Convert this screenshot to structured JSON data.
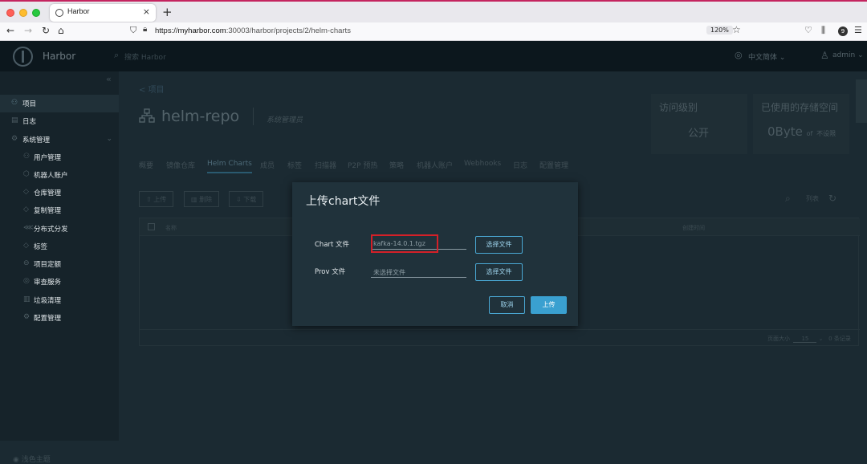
{
  "browser": {
    "tab_title": "Harbor",
    "tab_close": "×",
    "new_tab": "+",
    "url_scheme": "https://",
    "url_host": "myharbor.com",
    "url_path": ":30003/harbor/projects/2/helm-charts",
    "zoom": "120%",
    "badge_count": "9"
  },
  "header": {
    "brand": "Harbor",
    "search_placeholder": "搜索 Harbor",
    "language": "中文简体",
    "user": "admin"
  },
  "sidebar": {
    "items": [
      {
        "label": "项目",
        "icon": "project-icon"
      },
      {
        "label": "日志",
        "icon": "log-icon"
      },
      {
        "label": "系统管理",
        "icon": "admin-icon"
      },
      {
        "label": "用户管理",
        "icon": "users-icon"
      },
      {
        "label": "机器人账户",
        "icon": "robot-icon"
      },
      {
        "label": "仓库管理",
        "icon": "registry-icon"
      },
      {
        "label": "复制管理",
        "icon": "replication-icon"
      },
      {
        "label": "分布式分发",
        "icon": "distribution-icon"
      },
      {
        "label": "标签",
        "icon": "label-icon"
      },
      {
        "label": "项目定额",
        "icon": "quota-icon"
      },
      {
        "label": "审查服务",
        "icon": "scanner-icon"
      },
      {
        "label": "垃圾清理",
        "icon": "trash-icon"
      },
      {
        "label": "配置管理",
        "icon": "config-icon"
      }
    ],
    "theme_toggle": "浅色主题"
  },
  "project": {
    "back_link": "< 项目",
    "name": "helm-repo",
    "role": "系统管理员",
    "access_label": "访问级别",
    "access_value": "公开",
    "storage_label": "已使用的存储空间",
    "storage_value": "0Byte",
    "storage_of": "of",
    "storage_limit": "不设限"
  },
  "tabs": [
    "概要",
    "镜像仓库",
    "Helm Charts",
    "成员",
    "标签",
    "扫描器",
    "P2P 预热",
    "策略",
    "机器人账户",
    "Webhooks",
    "日志",
    "配置管理"
  ],
  "active_tab": "Helm Charts",
  "toolbar": {
    "upload": "上传",
    "delete": "删除",
    "download": "下载",
    "view_list": "列表"
  },
  "grid": {
    "col_name": "名称",
    "col_created": "创建时间",
    "page_size_label": "页面大小",
    "page_size": "15",
    "total": "0 条记录"
  },
  "modal": {
    "title": "上传chart文件",
    "chart_label": "Chart 文件",
    "chart_value": "kafka-14.0.1.tgz",
    "prov_label": "Prov 文件",
    "prov_placeholder": "未选择文件",
    "choose_file": "选择文件",
    "cancel": "取消",
    "upload": "上传"
  },
  "colors": {
    "highlight": "#d42028",
    "primary": "#3aa0d0",
    "modal_bg": "#20323b"
  }
}
